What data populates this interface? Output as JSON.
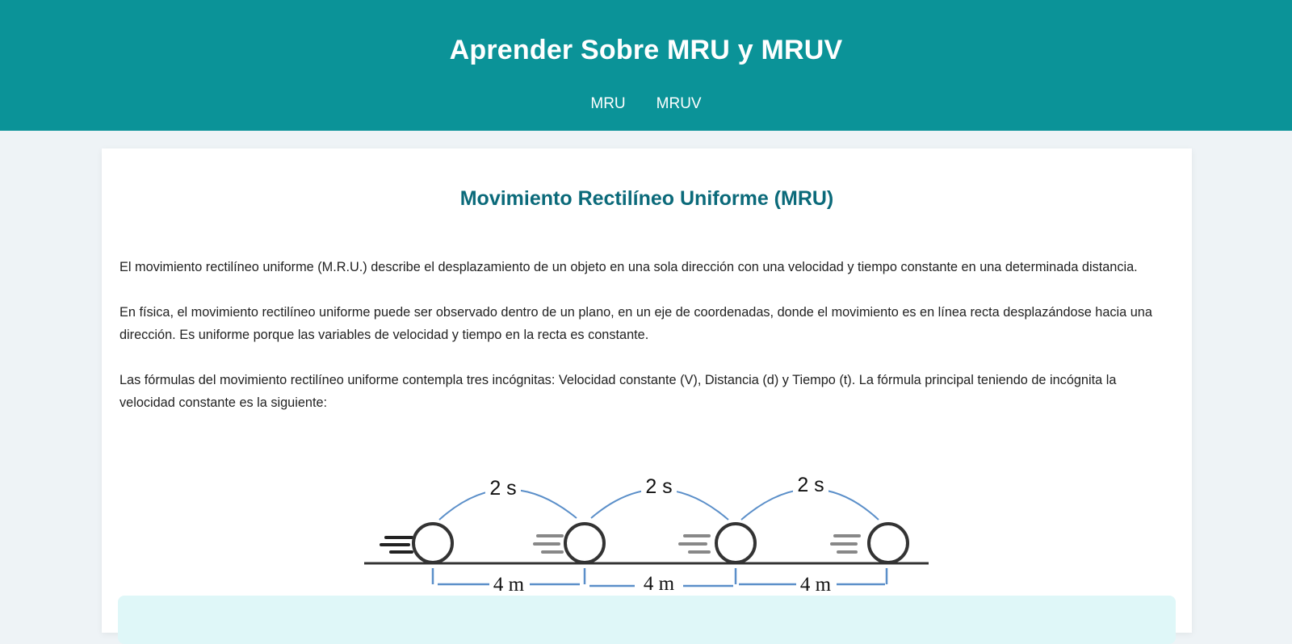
{
  "header": {
    "title": "Aprender Sobre MRU y MRUV",
    "nav": [
      {
        "label": "MRU"
      },
      {
        "label": "MRUV"
      }
    ]
  },
  "main": {
    "heading": "Movimiento Rectilíneo Uniforme (MRU)",
    "paragraphs": [
      "El movimiento rectilíneo uniforme (M.R.U.) describe el desplazamiento de un objeto en una sola dirección con una velocidad y tiempo constante en una determinada distancia.",
      "En física, el movimiento rectilíneo uniforme puede ser observado dentro de un plano, en un eje de coordenadas, donde el movimiento es en línea recta desplazándose hacia una dirección. Es uniforme porque las variables de velocidad y tiempo en la recta es constante.",
      "Las fórmulas del movimiento rectilíneo uniforme contempla tres incógnitas: Velocidad constante (V), Distancia (d) y Tiempo (t). La fórmula principal teniendo de incógnita la velocidad constante es la siguiente:"
    ],
    "diagram": {
      "time_labels": [
        "2 s",
        "2 s",
        "2 s"
      ],
      "distance_labels": [
        "4 m",
        "4 m",
        "4 m"
      ],
      "colors": {
        "arc": "#5b8fc9",
        "ball": "#333333",
        "lines_dark": "#222222",
        "lines_light": "#888888"
      }
    }
  },
  "colors": {
    "header_bg": "#0b9398",
    "page_bg": "#eef3f6",
    "heading": "#0b6a7a",
    "note_bg": "#dff7f8"
  }
}
